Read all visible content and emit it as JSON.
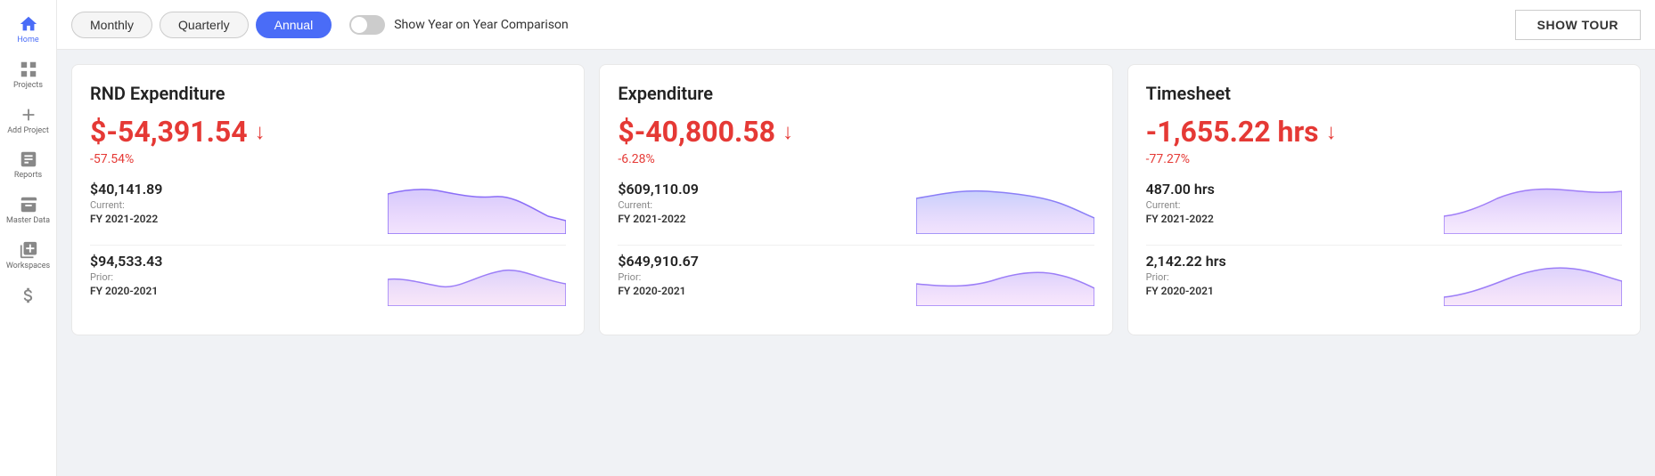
{
  "sidebar": {
    "items": [
      {
        "label": "Home",
        "icon": "home",
        "active": true
      },
      {
        "label": "Projects",
        "icon": "grid"
      },
      {
        "label": "Add Project",
        "icon": "plus"
      },
      {
        "label": "Reports",
        "icon": "reports"
      },
      {
        "label": "Master Data",
        "icon": "table"
      },
      {
        "label": "Workspaces",
        "icon": "workspaces"
      },
      {
        "label": "",
        "icon": "dollar"
      }
    ]
  },
  "topbar": {
    "tabs": [
      {
        "label": "Monthly",
        "active": false
      },
      {
        "label": "Quarterly",
        "active": false
      },
      {
        "label": "Annual",
        "active": true
      }
    ],
    "toggle_label": "Show Year on Year Comparison",
    "show_tour_label": "SHOW TOUR"
  },
  "cards": [
    {
      "title": "RND Expenditure",
      "main_value": "$-54,391.54",
      "percent": "-57.54%",
      "current_value": "$40,141.89",
      "current_label": "Current:",
      "current_period": "FY 2021-2022",
      "prior_value": "$94,533.43",
      "prior_label": "Prior:",
      "prior_period": "FY 2020-2021",
      "current_chart": "current1",
      "prior_chart": "prior1"
    },
    {
      "title": "Expenditure",
      "main_value": "$-40,800.58",
      "percent": "-6.28%",
      "current_value": "$609,110.09",
      "current_label": "Current:",
      "current_period": "FY 2021-2022",
      "prior_value": "$649,910.67",
      "prior_label": "Prior:",
      "prior_period": "FY 2020-2021",
      "current_chart": "current2",
      "prior_chart": "prior2"
    },
    {
      "title": "Timesheet",
      "main_value": "-1,655.22 hrs",
      "percent": "-77.27%",
      "current_value": "487.00 hrs",
      "current_label": "Current:",
      "current_period": "FY 2021-2022",
      "prior_value": "2,142.22 hrs",
      "prior_label": "Prior:",
      "prior_period": "FY 2020-2021",
      "current_chart": "current3",
      "prior_chart": "prior3"
    }
  ],
  "colors": {
    "accent": "#4a6cf7",
    "negative": "#e53935",
    "chart_fill": "rgba(150, 100, 200, 0.4)",
    "chart_stroke": "#7c6ef7"
  }
}
